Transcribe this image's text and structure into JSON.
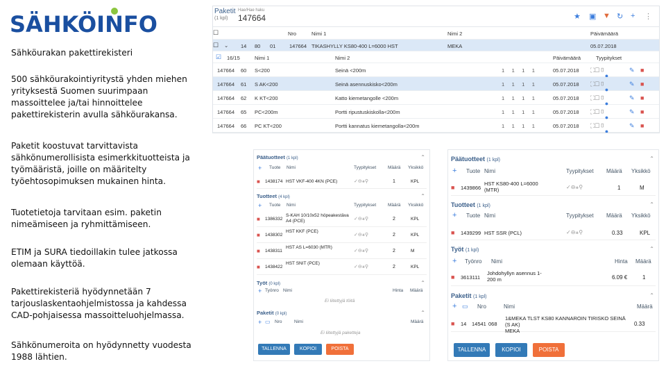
{
  "logo": {
    "text": "SÄHKÖINFO",
    "color": "#1a4fa0",
    "accent": "#8cc63f"
  },
  "intro": [
    "Sähköurakan pakettirekisteri",
    "500 sähköurakointiyritystä yhden miehen yrityksestä Suomen suurimpaan massoittelee ja/tai hinnoittelee pakettirekisterin avulla sähköurakansa.",
    "Paketit koostuvat tarvittavista sähkönumerollisista esimerkkituotteista ja työmääristä, joille on määritelty työehtosopimuksen mukainen hinta.",
    "Tuotetietoja tarvitaan esim. paketin nimeämiseen ja ryhmittämiseen.",
    "ETIM ja SURA tiedoillakin tulee jatkossa olemaan käyttöä.",
    "Pakettirekisteriä hyödynnetään 7 tarjouslaskentaohjelmistossa ja kahdessa CAD-pohjaisessa massoitteluohjelmassa.",
    "Sähkönumeroita on hyödynnetty vuodesta 1988 lähtien."
  ],
  "shot": {
    "title": "Paketit",
    "title_sub": "(1 kpl)",
    "search_label": "Hae/Hae haku",
    "search_value": "147664",
    "cols": [
      "Nro",
      "Nimi 1",
      "Nimi 2",
      "Päivämäärä"
    ],
    "main_row": {
      "c1": "14",
      "c2": "80",
      "c3": "01",
      "c4": "147664",
      "name": "TIKASHYLLY KS80-400 L=6000 HST",
      "name2": "MEKA",
      "date": "05.07.2018"
    },
    "sub_head": {
      "count": "16/15",
      "c2": "Nimi 1",
      "c3": "Nimi 2",
      "c4": "Päivämäärä",
      "c5": "Tyypitykset"
    },
    "rows": [
      {
        "id": "147664",
        "n": "60",
        "name": "S<200",
        "name2": "Seinä <200m",
        "date": "05.07.2018"
      },
      {
        "id": "147664",
        "n": "61",
        "name": "S AK<200",
        "name2": "Seinä asennuskisko<200m",
        "date": "05.07.2018"
      },
      {
        "id": "147664",
        "n": "62",
        "name": "K KT<200",
        "name2": "Katto kiemetangolle <200m",
        "date": "05.07.2018"
      },
      {
        "id": "147664",
        "n": "65",
        "name": "PC<200m",
        "name2": "Portti ripustuskiskolla<200m",
        "date": "05.07.2018"
      },
      {
        "id": "147664",
        "n": "66",
        "name": "PC KT<200",
        "name2": "Portti kannatus kiemetangolla<200m",
        "date": "05.07.2018"
      }
    ]
  },
  "left_panel": {
    "paatuotteet": "Päätuotteet",
    "paatuotteet_cnt": "(1 kpl)",
    "tuotteet": "Tuotteet",
    "tuotteet_cnt": "(4 kpl)",
    "cols": [
      "Tuote",
      "Nimi",
      "Tyypitykset",
      "Määrä",
      "Yksikkö"
    ],
    "main_item": {
      "code": "1438174",
      "name": "HST VKF-400 4KN (PCE)",
      "qty": "1",
      "unit": "KPL"
    },
    "items": [
      {
        "code": "1386332",
        "name": "S-KAH 10/10x52 höpeakestäva A4 (PCE)",
        "qty": "2",
        "unit": "KPL"
      },
      {
        "code": "1438302",
        "name": "HST KKF (PCE)",
        "qty": "2",
        "unit": "KPL"
      },
      {
        "code": "1438311",
        "name": "HST AS L=6030 (MTR)",
        "qty": "2",
        "unit": "M"
      },
      {
        "code": "1438422",
        "name": "HST SNIT (PCE)",
        "qty": "2",
        "unit": "KPL"
      }
    ],
    "tyot": "Työt",
    "tyot_cnt": "(0 kpl)",
    "tyot_cols": [
      "Työnro",
      "Nimi",
      "Hinta",
      "Määrä"
    ],
    "tyot_empty": "Ei liitettyjä töitä",
    "paketit": "Paketit",
    "paketit_cnt": "(0 kpl)",
    "paketit_cols": [
      "Nro",
      "Nimi",
      "Määrä"
    ],
    "paketit_empty": "Ei liitettyjä paketteja",
    "buttons": [
      "TALLENNA",
      "KOPIOI",
      "POISTA"
    ]
  },
  "right_panel": {
    "paatuotteet": "Päätuotteet",
    "paatuotteet_cnt": "(1 kpl)",
    "cols": [
      "Tuote",
      "Nimi",
      "Tyypitykset",
      "Määrä",
      "Yksikkö"
    ],
    "main_item": {
      "code": "1439866",
      "name": "HST KS80-400 L=6000 (MTR)",
      "qty": "1",
      "unit": "M"
    },
    "tuotteet": "Tuotteet",
    "tuotteet_cnt": "(1 kpl)",
    "item": {
      "code": "1439299",
      "name": "HST SSR (PCL)",
      "qty": "0.33",
      "unit": "KPL"
    },
    "tyot": "Työt",
    "tyot_cnt": "(1 kpl)",
    "tyot_cols": [
      "Työnro",
      "Nimi",
      "Hinta",
      "Määrä"
    ],
    "tyo": {
      "code": "3613111",
      "name": "Johdohyllyn asennus 1-200 m",
      "price": "6.09 €",
      "qty": "1"
    },
    "paketit": "Paketit",
    "paketit_cnt": "(1 kpl)",
    "paketit_cols": [
      "Nro",
      "Nimi",
      "Määrä"
    ],
    "paketti": {
      "nro": "14",
      "code": "14541",
      "n": "068",
      "name": "1&MEKA TLST KS80 KANNAROIN TIRISKO SEINÄ (S AK)",
      "sub": "MEKA",
      "qty": "0.33"
    },
    "buttons": [
      "TALLENNA",
      "KOPIOI",
      "POISTA"
    ]
  }
}
